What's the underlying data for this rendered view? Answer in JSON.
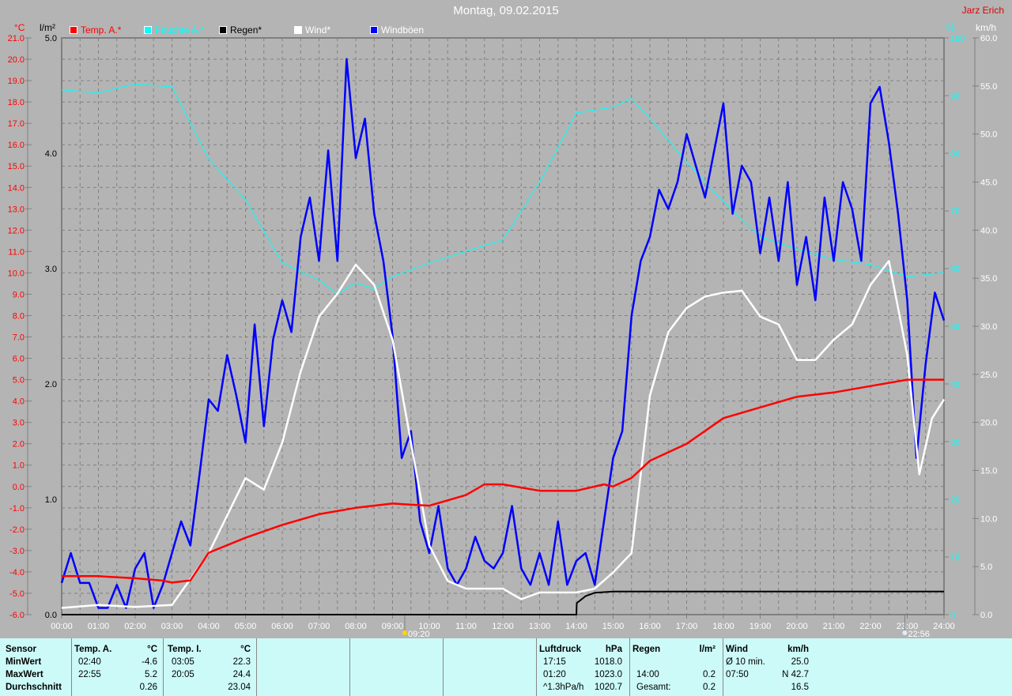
{
  "header": {
    "title": "Montag, 09.02.2015",
    "author": "Jarz Erich"
  },
  "legend": [
    {
      "label": "Temp. A.*",
      "color": "#ff0000"
    },
    {
      "label": "Feuchte A.*",
      "color": "#00ffff"
    },
    {
      "label": "Regen*",
      "color": "#000000"
    },
    {
      "label": "Wind*",
      "color": "#ffffff"
    },
    {
      "label": "Windböen",
      "color": "#0000ff"
    }
  ],
  "axis_units": {
    "temp": "°C",
    "rain": "l/m²",
    "humidity": "%",
    "wind": "km/h"
  },
  "markers": [
    {
      "label": "09:20",
      "hour": 9.333
    },
    {
      "label": "22:56",
      "hour": 22.933
    }
  ],
  "chart_data": {
    "type": "line",
    "title": "Montag, 09.02.2015",
    "xlabel": "",
    "xlim": [
      0,
      24
    ],
    "x_ticks": [
      "00:00",
      "01:00",
      "02:00",
      "03:00",
      "04:00",
      "05:00",
      "06:00",
      "07:00",
      "08:00",
      "09:00",
      "10:00",
      "11:00",
      "12:00",
      "13:00",
      "14:00",
      "15:00",
      "16:00",
      "17:00",
      "18:00",
      "19:00",
      "20:00",
      "21:00",
      "22:00",
      "23:00",
      "24:00"
    ],
    "axes": {
      "temp": {
        "range": [
          -6,
          21
        ],
        "ticks": [
          "21.0",
          "20.0",
          "19.0",
          "18.0",
          "17.0",
          "16.0",
          "15.0",
          "14.0",
          "13.0",
          "12.0",
          "11.0",
          "10.0",
          "9.0",
          "8.0",
          "7.0",
          "6.0",
          "5.0",
          "4.0",
          "3.0",
          "2.0",
          "1.0",
          "0.0",
          "-1.0",
          "-2.0",
          "-3.0",
          "-4.0",
          "-5.0",
          "-6.0"
        ]
      },
      "rain": {
        "range": [
          0,
          5
        ],
        "ticks": [
          "5.0",
          "4.0",
          "3.0",
          "2.0",
          "1.0",
          "0.0"
        ]
      },
      "humidity": {
        "range": [
          0,
          100
        ],
        "ticks": [
          "100",
          "90",
          "80",
          "70",
          "60",
          "50",
          "40",
          "30",
          "20",
          "10",
          "0"
        ]
      },
      "wind": {
        "range": [
          0,
          60
        ],
        "ticks": [
          "60.0",
          "55.0",
          "50.0",
          "45.0",
          "40.0",
          "35.0",
          "30.0",
          "25.0",
          "20.0",
          "15.0",
          "10.0",
          "5.0",
          "0.0"
        ]
      }
    },
    "grid": true,
    "legend_position": "top",
    "series": [
      {
        "name": "Temp. A.*",
        "axis": "temp",
        "color": "#ff0000",
        "x": [
          0,
          1,
          2,
          2.7,
          3,
          3.5,
          4,
          5,
          6,
          7,
          8,
          9,
          10,
          11,
          11.5,
          12,
          13,
          14,
          14.75,
          15,
          15.5,
          16,
          17,
          18,
          19,
          20,
          21,
          22,
          23,
          24
        ],
        "y": [
          -4.2,
          -4.2,
          -4.3,
          -4.4,
          -4.5,
          -4.4,
          -3.1,
          -2.4,
          -1.8,
          -1.3,
          -1.0,
          -0.8,
          -0.9,
          -0.4,
          0.1,
          0.1,
          -0.2,
          -0.2,
          0.1,
          0.0,
          0.4,
          1.2,
          2.0,
          3.2,
          3.7,
          4.2,
          4.4,
          4.7,
          5.0,
          5.0
        ]
      },
      {
        "name": "Feuchte A.*",
        "axis": "humidity",
        "color": "#00ffff",
        "x": [
          0,
          1,
          2,
          3,
          4,
          5,
          6,
          7,
          7.5,
          8,
          8.5,
          9,
          10,
          11,
          12,
          13,
          14,
          15,
          15.5,
          16,
          17,
          18,
          19,
          20,
          21,
          22,
          23,
          24
        ],
        "y": [
          91,
          90.5,
          92,
          91.5,
          79,
          72,
          61,
          58,
          55.6,
          57.5,
          56.5,
          58.6,
          61,
          63,
          65,
          75,
          87,
          88,
          89.5,
          86,
          78.5,
          71.6,
          65.5,
          63.4,
          61.6,
          60.7,
          58.6,
          59.3
        ]
      },
      {
        "name": "Regen*",
        "axis": "rain",
        "color": "#000000",
        "x": [
          0,
          14,
          14.01,
          14.25,
          14.5,
          15,
          24
        ],
        "y": [
          0,
          0,
          0.1,
          0.16,
          0.19,
          0.2,
          0.2
        ]
      },
      {
        "name": "Wind*",
        "axis": "wind",
        "color": "#ffffff",
        "x": [
          0,
          1,
          2,
          3,
          4,
          5,
          5.5,
          6,
          6.5,
          7,
          7.5,
          8,
          8.5,
          9,
          9.5,
          10,
          10.5,
          11,
          12,
          12.5,
          13,
          14,
          14.5,
          15,
          15.5,
          16,
          16.5,
          17,
          17.5,
          18,
          18.5,
          19,
          19.5,
          20,
          20.5,
          21,
          21.5,
          22,
          22.5,
          23,
          23.33,
          23.67,
          24
        ],
        "y": [
          0.7,
          1,
          0.8,
          1,
          6.4,
          14.2,
          13,
          17.9,
          25.3,
          31,
          33.4,
          36.4,
          34.3,
          28.6,
          17.9,
          7.2,
          3.5,
          2.7,
          2.7,
          1.6,
          2.3,
          2.3,
          2.7,
          4.4,
          6.4,
          22.8,
          29.4,
          31.9,
          33.1,
          33.5,
          33.7,
          31,
          30.2,
          26.5,
          26.5,
          28.6,
          30.2,
          34.3,
          36.8,
          27,
          14.6,
          20.4,
          22.4
        ]
      },
      {
        "name": "Windböen",
        "axis": "wind",
        "color": "#0000ff",
        "step": 0.25,
        "y": [
          3.3,
          6.4,
          3.3,
          3.3,
          0.7,
          0.7,
          3.1,
          0.7,
          4.8,
          6.4,
          0.7,
          3.1,
          6.4,
          9.7,
          7.2,
          14.6,
          22.4,
          21.2,
          27.0,
          22.8,
          17.9,
          30.2,
          19.6,
          28.6,
          32.7,
          29.4,
          39.3,
          43.4,
          36.8,
          48.3,
          36.8,
          57.8,
          47.5,
          51.6,
          41.7,
          36.8,
          29.0,
          16.3,
          19.1,
          9.7,
          6.4,
          11.3,
          4.8,
          3.1,
          4.8,
          8.1,
          5.6,
          4.8,
          6.4,
          11.3,
          4.8,
          3.1,
          6.4,
          3.1,
          9.7,
          3.1,
          5.6,
          6.4,
          3.1,
          9.7,
          16.3,
          19.1,
          31.1,
          36.8,
          39.3,
          44.2,
          42.2,
          45.0,
          50.0,
          46.7,
          43.4,
          48.3,
          53.2,
          41.7,
          46.7,
          45.0,
          37.6,
          43.4,
          36.8,
          45.0,
          34.3,
          39.3,
          32.7,
          43.4,
          36.8,
          45.0,
          42.2,
          36.8,
          53.2,
          54.9,
          49.1,
          41.7,
          32.7,
          16.3,
          26.1,
          33.5,
          30.6
        ]
      }
    ]
  },
  "table": {
    "row_labels": [
      "Sensor",
      "MinWert",
      "MaxWert",
      "Durchschnitt"
    ],
    "groups": [
      {
        "header": "Temp. A.",
        "unit": "°C",
        "rows": [
          [
            "02:40",
            "-4.6"
          ],
          [
            "22:55",
            "5.2"
          ],
          [
            "",
            "0.26"
          ]
        ]
      },
      {
        "header": "Temp. I.",
        "unit": "°C",
        "rows": [
          [
            "03:05",
            "22.3"
          ],
          [
            "20:05",
            "24.4"
          ],
          [
            "",
            "23.04"
          ]
        ]
      },
      {
        "header": "Luftdruck",
        "unit": "hPa",
        "rows": [
          [
            "17:15",
            "1018.0"
          ],
          [
            "01:20",
            "1023.0"
          ],
          [
            "^1.3hPa/h",
            "1020.7"
          ]
        ]
      },
      {
        "header": "Regen",
        "unit": "l/m²",
        "rows": [
          [
            "",
            ""
          ],
          [
            "14:00",
            "0.2"
          ],
          [
            "Gesamt:",
            "0.2"
          ]
        ]
      },
      {
        "header": "Wind",
        "unit": "km/h",
        "rows": [
          [
            "Ø 10 min.",
            "25.0"
          ],
          [
            "07:50",
            "N 42.7"
          ],
          [
            "",
            "16.5"
          ]
        ]
      }
    ]
  }
}
